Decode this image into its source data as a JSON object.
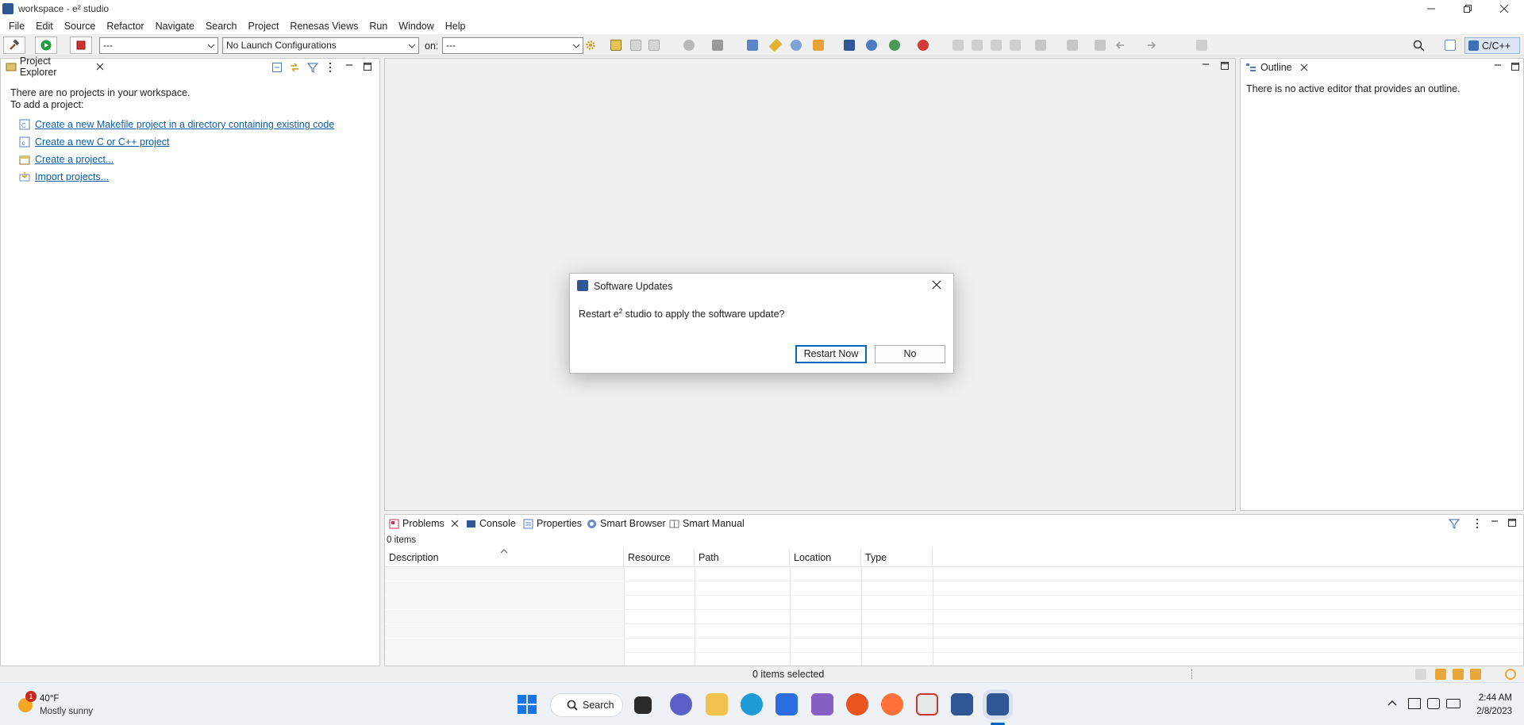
{
  "window": {
    "title": "workspace - e² studio"
  },
  "menu": [
    "File",
    "Edit",
    "Source",
    "Refactor",
    "Navigate",
    "Search",
    "Project",
    "Renesas Views",
    "Run",
    "Window",
    "Help"
  ],
  "toolbar": {
    "target_combo": "---",
    "launch_combo": "No Launch Configurations",
    "on_label": "on:",
    "on_combo": "---",
    "perspective": "C/C++"
  },
  "project_explorer": {
    "tab": "Project Explorer",
    "line1": "There are no projects in your workspace.",
    "line2": "To add a project:",
    "links": [
      "Create a new Makefile project in a directory containing existing code",
      "Create a new C or C++ project",
      "Create a project...",
      "Import projects..."
    ]
  },
  "outline": {
    "tab": "Outline",
    "message": "There is no active editor that provides an outline."
  },
  "bottom": {
    "tabs": [
      "Problems",
      "Console",
      "Properties",
      "Smart Browser",
      "Smart Manual"
    ],
    "count": "0 items",
    "columns": [
      "Description",
      "Resource",
      "Path",
      "Location",
      "Type"
    ]
  },
  "status": {
    "text": "0 items selected"
  },
  "dialog": {
    "title": "Software Updates",
    "message_pre": "Restart e",
    "message_sup": "2",
    "message_post": " studio to apply the software update?",
    "restart_label": "Restart Now",
    "no_label": "No"
  },
  "taskbar": {
    "weather_temp": "40°F",
    "weather_desc": "Mostly sunny",
    "weather_badge": "1",
    "search_label": "Search",
    "time": "2:44 AM",
    "date": "2/8/2023"
  },
  "colors": {
    "accent": "#0067c0",
    "link": "#0b5fad",
    "brand": "#2f5796"
  }
}
